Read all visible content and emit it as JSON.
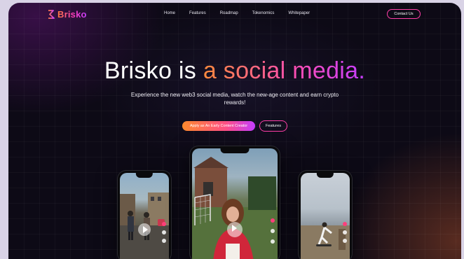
{
  "brand": {
    "name": "Brisko"
  },
  "nav": {
    "items": [
      "Home",
      "Features",
      "Roadmap",
      "Tokenomics",
      "Whitepaper"
    ]
  },
  "header": {
    "contact_label": "Contact Us"
  },
  "hero": {
    "headline_plain": "Brisko is ",
    "headline_gradient": "a social media.",
    "subtitle": "Experience the new web3 social media, watch the new-age content and earn crypto rewards!",
    "cta_primary": "Apply as An Early Content Creator",
    "cta_secondary": "Features"
  },
  "colors": {
    "accent_pink": "#ff3fa8",
    "accent_orange": "#ff8a2d",
    "accent_purple": "#c43dff",
    "background": "#0d0a16"
  },
  "icons": [
    "brisko-logo-icon",
    "play-icon",
    "heart-icon",
    "comment-icon",
    "share-icon"
  ]
}
